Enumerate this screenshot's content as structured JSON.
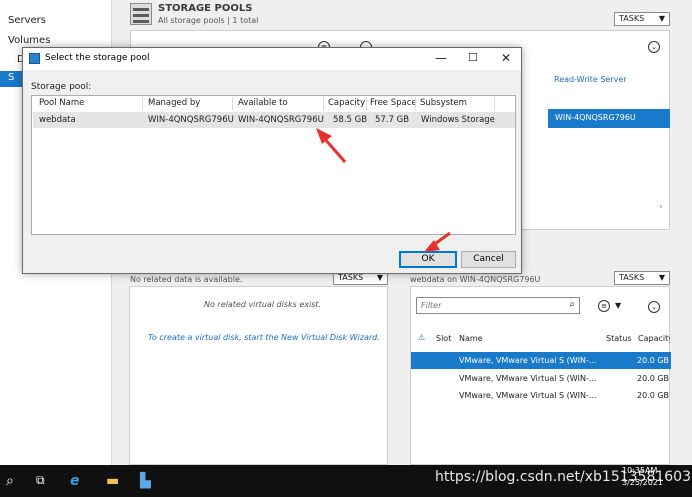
{
  "nav": {
    "items": [
      "Servers",
      "Volumes",
      "D",
      "S"
    ]
  },
  "storage_pools": {
    "title": "STORAGE POOLS",
    "subtitle": "All storage pools | 1 total",
    "tasks_label": "TASKS",
    "rw_header": "Read-Write Server",
    "rw_selected": "WIN-4QNQSRG796U"
  },
  "virtual_disks": {
    "header": "No related data is available.",
    "tasks_label": "TASKS",
    "empty_text": "No related virtual disks exist.",
    "wizard_link": "To create a virtual disk, start the New Virtual Disk Wizard."
  },
  "physical_disks": {
    "header": "webdata on WIN-4QNQSRG796U",
    "tasks_label": "TASKS",
    "filter_placeholder": "Filter",
    "columns": {
      "slot": "Slot",
      "name": "Name",
      "status": "Status",
      "capacity": "Capacity"
    },
    "rows": [
      {
        "name": "VMware, VMware Virtual S (WIN-...",
        "capacity": "20.0 GB",
        "selected": true
      },
      {
        "name": "VMware, VMware Virtual S (WIN-...",
        "capacity": "20.0 GB",
        "selected": false
      },
      {
        "name": "VMware, VMware Virtual S (WIN-...",
        "capacity": "20.0 GB",
        "selected": false
      }
    ]
  },
  "dialog": {
    "title": "Select the storage pool",
    "pool_label": "Storage pool:",
    "columns": {
      "pool_name": "Pool Name",
      "managed_by": "Managed by",
      "available_to": "Available to",
      "capacity": "Capacity",
      "free_space": "Free Space",
      "subsystem": "Subsystem"
    },
    "row": {
      "pool_name": "webdata",
      "managed_by": "WIN-4QNQSRG796U",
      "available_to": "WIN-4QNQSRG796U",
      "capacity": "58.5 GB",
      "free_space": "57.7 GB",
      "subsystem": "Windows Storage"
    },
    "ok_label": "OK",
    "cancel_label": "Cancel"
  },
  "taskbar": {
    "watermark": "https://blog.csdn.net/xb1513581603",
    "time": "10:35AM",
    "date": "3/25/2021"
  },
  "colors": {
    "selection": "#1979ca",
    "arrow": "#e5322d",
    "link": "#1b6ec2"
  }
}
